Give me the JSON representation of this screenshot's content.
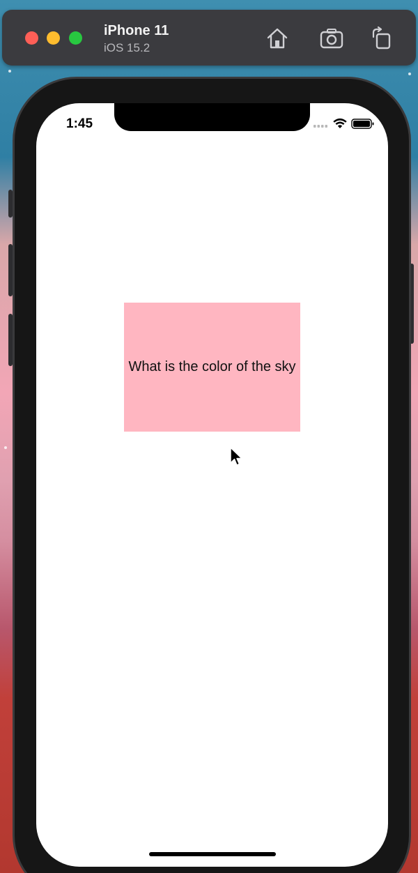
{
  "simulator": {
    "device_name": "iPhone 11",
    "os_version": "iOS 15.2",
    "toolbar_icons": [
      "home-icon",
      "screenshot-icon",
      "rotate-icon"
    ]
  },
  "status_bar": {
    "time": "1:45",
    "icons": [
      "cellular-signal-icon",
      "wifi-icon",
      "battery-icon"
    ]
  },
  "content": {
    "question_text": "What is the color of the sky",
    "box_color": "#ffb6c1"
  }
}
